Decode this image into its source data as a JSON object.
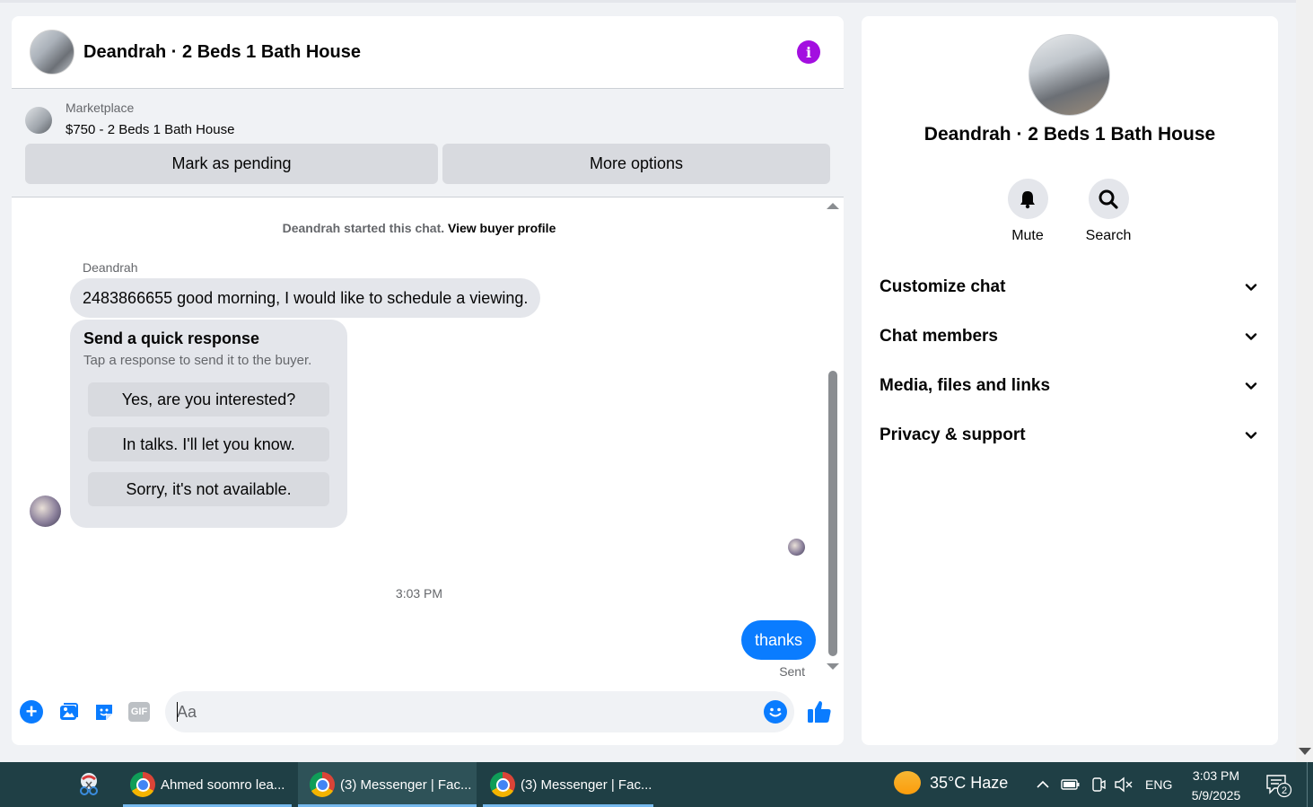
{
  "chat": {
    "title": "Deandrah · 2 Beds 1 Bath House",
    "info_icon": "i",
    "marketplace": {
      "label": "Marketplace",
      "listing": "$750 - 2 Beds 1 Bath House",
      "mark_pending": "Mark as pending",
      "more_options": "More options"
    },
    "started_text": "Deandrah started this chat.",
    "view_buyer_profile": "View buyer profile",
    "sender_name": "Deandrah",
    "incoming_message": "2483866655 good morning, I would like to schedule a viewing.",
    "quick_response": {
      "title": "Send a quick response",
      "subtitle": "Tap a response to send it to the buyer.",
      "options": [
        "Yes, are you interested?",
        "In talks. I'll let you know.",
        "Sorry, it's not available."
      ]
    },
    "timestamp": "3:03 PM",
    "outgoing_message": "thanks",
    "sent_status": "Sent",
    "composer": {
      "placeholder": "Aa",
      "gif_label": "GIF",
      "plus_icon": "+"
    }
  },
  "info_panel": {
    "name": "Deandrah · 2 Beds 1 Bath House",
    "actions": [
      {
        "label": "Mute",
        "icon": "bell-icon"
      },
      {
        "label": "Search",
        "icon": "search-icon"
      }
    ],
    "sections": [
      "Customize chat",
      "Chat members",
      "Media, files and links",
      "Privacy & support"
    ]
  },
  "taskbar": {
    "items": [
      "Ahmed soomro lea...",
      "(3) Messenger | Fac...",
      "(3) Messenger | Fac..."
    ],
    "weather": "35°C  Haze",
    "language": "ENG",
    "time": "3:03 PM",
    "date": "5/9/2025",
    "notification_count": "2"
  },
  "colors": {
    "accent": "#0a7cff",
    "info": "#a30fe0",
    "taskbar": "#1f3f45"
  }
}
